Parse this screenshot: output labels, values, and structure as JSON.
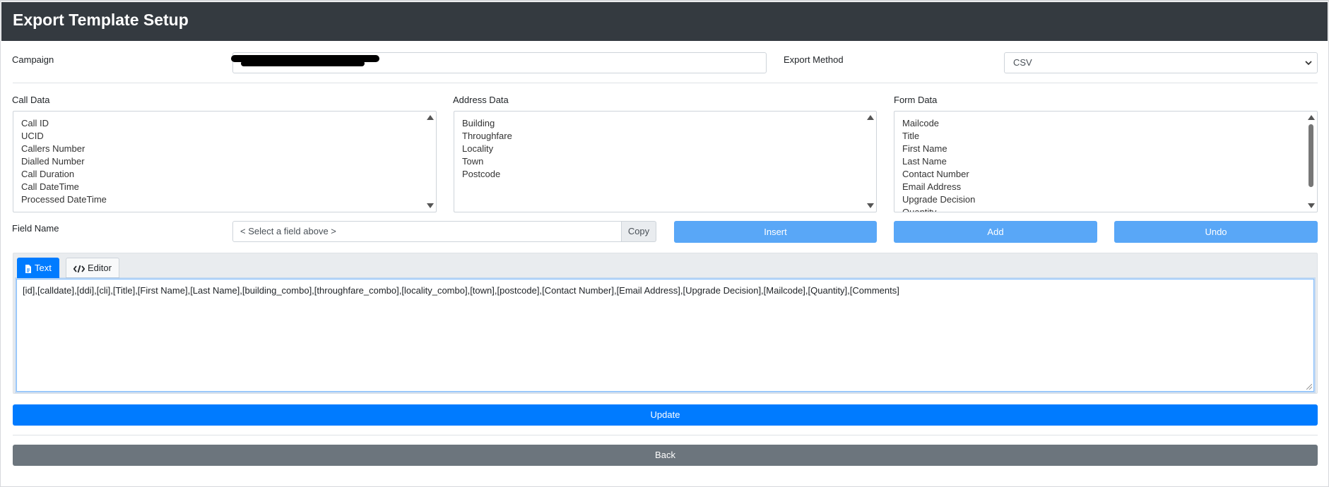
{
  "header": {
    "title": "Export Template Setup"
  },
  "form": {
    "campaign_label": "Campaign",
    "campaign_value": "",
    "export_method_label": "Export Method",
    "export_method_value": "CSV",
    "field_name_label": "Field Name",
    "field_name_placeholder": "< Select a field above >",
    "copy_label": "Copy"
  },
  "lists": {
    "call_data": {
      "label": "Call Data",
      "items": [
        "Call ID",
        "UCID",
        "Callers Number",
        "Dialled Number",
        "Call Duration",
        "Call DateTime",
        "Processed DateTime"
      ]
    },
    "address_data": {
      "label": "Address Data",
      "items": [
        "Building",
        "Throughfare",
        "Locality",
        "Town",
        "Postcode"
      ]
    },
    "form_data": {
      "label": "Form Data",
      "items": [
        "Mailcode",
        "Title",
        "First Name",
        "Last Name",
        "Contact Number",
        "Email Address",
        "Upgrade Decision",
        "Quantity"
      ]
    }
  },
  "buttons": {
    "insert": "Insert",
    "add": "Add",
    "undo": "Undo",
    "update": "Update",
    "back": "Back"
  },
  "tabs": {
    "text": "Text",
    "editor": "Editor"
  },
  "template_text": "[id],[calldate],[ddi],[cli],[Title],[First Name],[Last Name],[building_combo],[throughfare_combo],[locality_combo],[town],[postcode],[Contact Number],[Email Address],[Upgrade Decision],[Mailcode],[Quantity],[Comments]",
  "colors": {
    "header_bg": "#343a40",
    "primary": "#007bff",
    "light_blue": "#59a7f7",
    "secondary": "#6c757d"
  },
  "icons": {
    "text_tab": "file-text-icon",
    "editor_tab": "code-icon",
    "select": "chevron-down-icon"
  }
}
